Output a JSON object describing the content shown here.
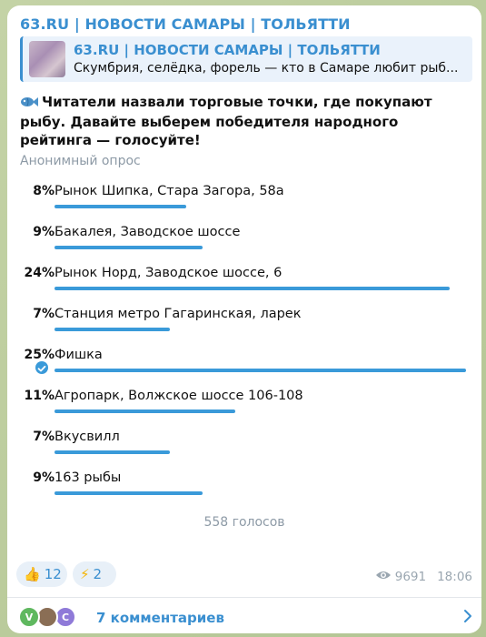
{
  "channel": {
    "name": "63.RU | НОВОСТИ САМАРЫ | ТОЛЬЯТТИ"
  },
  "reply": {
    "title": "63.RU | НОВОСТИ САМАРЫ | ТОЛЬЯТТИ",
    "text": "Скумбрия, селёдка, форель — кто в Самаре любит рыб..."
  },
  "poll": {
    "question": "Читатели назвали торговые точки, где покупают рыбу. Давайте выберем победителя народного рейтинга — голосуйте!",
    "type_label": "Анонимный опрос",
    "options": [
      {
        "percent": "8%",
        "label": "Рынок Шипка, Стара Загора, 58а",
        "value": 8,
        "chosen": false
      },
      {
        "percent": "9%",
        "label": "Бакалея, Заводское шоссе",
        "value": 9,
        "chosen": false
      },
      {
        "percent": "24%",
        "label": "Рынок Норд, Заводское шоссе, 6",
        "value": 24,
        "chosen": false
      },
      {
        "percent": "7%",
        "label": "Станция метро Гагаринская, ларек",
        "value": 7,
        "chosen": false
      },
      {
        "percent": "25%",
        "label": "Фишка",
        "value": 25,
        "chosen": true
      },
      {
        "percent": "11%",
        "label": "Агропарк, Волжское шоссе 106-108",
        "value": 11,
        "chosen": false
      },
      {
        "percent": "7%",
        "label": "Вкусвилл",
        "value": 7,
        "chosen": false
      },
      {
        "percent": "9%",
        "label": "163 рыбы",
        "value": 9,
        "chosen": false
      }
    ],
    "votes_label": "558 голосов"
  },
  "reactions": [
    {
      "icon": "thumbs-up-icon",
      "emoji": "👍",
      "count": "12"
    },
    {
      "icon": "lightning-icon",
      "emoji": "⚡",
      "count": "2"
    }
  ],
  "meta": {
    "views": "9691",
    "time": "18:06"
  },
  "comments": {
    "label": "7 комментариев",
    "avatars": [
      {
        "letter": "V",
        "color": "#5fb85f"
      },
      {
        "letter": "",
        "color": "#8a6e55"
      },
      {
        "letter": "C",
        "color": "#8f7ad8"
      }
    ]
  },
  "colors": {
    "accent": "#3a8fd0",
    "bar": "#3a9ad9"
  }
}
